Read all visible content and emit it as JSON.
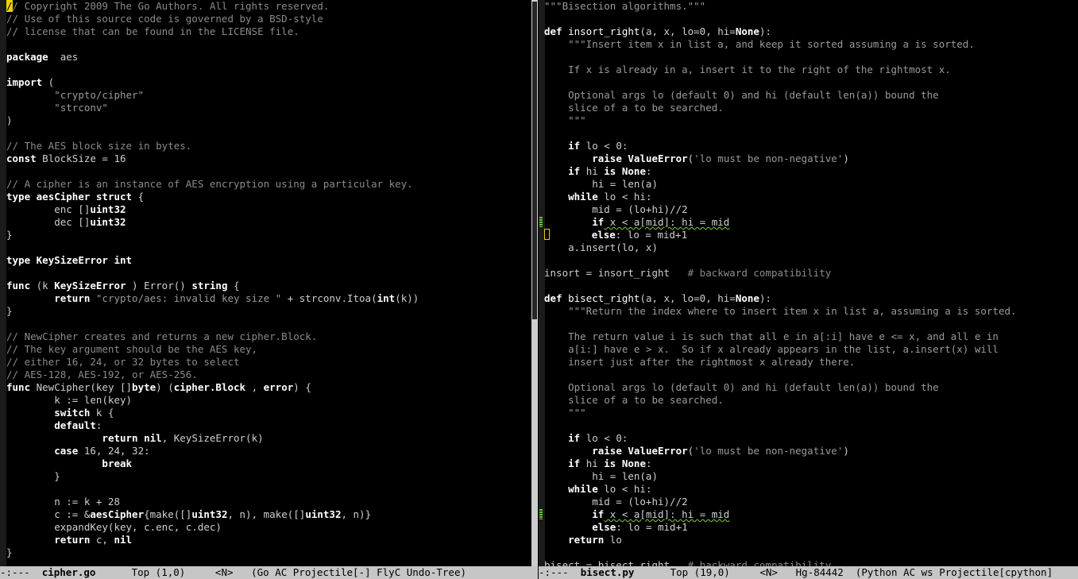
{
  "left": {
    "lines": [
      [
        [
          "cursor",
          "/"
        ],
        [
          "cm",
          "/ Copyright 2009 The Go Authors. All rights reserved."
        ]
      ],
      [
        [
          "cm",
          "// Use of this source code is governed by a BSD-style"
        ]
      ],
      [
        [
          "cm",
          "// license that can be found in the LICENSE file."
        ]
      ],
      [],
      [
        [
          "kw",
          "package"
        ],
        [
          "",
          "  aes"
        ]
      ],
      [],
      [
        [
          "kw",
          "import"
        ],
        [
          "",
          " ("
        ]
      ],
      [
        [
          "",
          "        "
        ],
        [
          "st",
          "\"crypto/cipher\""
        ]
      ],
      [
        [
          "",
          "        "
        ],
        [
          "st",
          "\"strconv\""
        ]
      ],
      [
        [
          "",
          ")"
        ]
      ],
      [],
      [
        [
          "cm",
          "// The AES block size in bytes."
        ]
      ],
      [
        [
          "kw",
          "const"
        ],
        [
          "",
          " BlockSize = 16"
        ]
      ],
      [],
      [
        [
          "cm",
          "// A cipher is an instance of AES encryption using a particular key."
        ]
      ],
      [
        [
          "kw",
          "type"
        ],
        [
          "",
          " "
        ],
        [
          "tp",
          "aesCipher"
        ],
        [
          "",
          " "
        ],
        [
          "kw",
          "struct"
        ],
        [
          "",
          " {"
        ]
      ],
      [
        [
          "",
          "        enc []"
        ],
        [
          "tp",
          "uint32"
        ]
      ],
      [
        [
          "",
          "        dec []"
        ],
        [
          "tp",
          "uint32"
        ]
      ],
      [
        [
          "",
          "}"
        ]
      ],
      [],
      [
        [
          "kw",
          "type"
        ],
        [
          "",
          " "
        ],
        [
          "tp",
          "KeySizeError"
        ],
        [
          "",
          " "
        ],
        [
          "tp",
          "int"
        ]
      ],
      [],
      [
        [
          "kw",
          "func"
        ],
        [
          "",
          " (k "
        ],
        [
          "tp",
          "KeySizeError"
        ],
        [
          "",
          " ) Error() "
        ],
        [
          "tp",
          "string"
        ],
        [
          "",
          " {"
        ]
      ],
      [
        [
          "",
          "        "
        ],
        [
          "kw",
          "return"
        ],
        [
          "",
          " "
        ],
        [
          "st",
          "\"crypto/aes: invalid key size \""
        ],
        [
          "",
          " + strconv.Itoa("
        ],
        [
          "tp",
          "int"
        ],
        [
          "",
          "(k))"
        ]
      ],
      [
        [
          "",
          "}"
        ]
      ],
      [],
      [
        [
          "cm",
          "// NewCipher creates and returns a new cipher.Block."
        ]
      ],
      [
        [
          "cm",
          "// The key argument should be the AES key,"
        ]
      ],
      [
        [
          "cm",
          "// either 16, 24, or 32 bytes to select"
        ]
      ],
      [
        [
          "cm",
          "// AES-128, AES-192, or AES-256."
        ]
      ],
      [
        [
          "kw",
          "func"
        ],
        [
          "",
          " NewCipher(key []"
        ],
        [
          "tp",
          "byte"
        ],
        [
          "",
          ") ("
        ],
        [
          "tp",
          "cipher.Block"
        ],
        [
          "",
          " , "
        ],
        [
          "tp",
          "error"
        ],
        [
          "",
          ") {"
        ]
      ],
      [
        [
          "",
          "        k := len(key)"
        ]
      ],
      [
        [
          "",
          "        "
        ],
        [
          "kw",
          "switch"
        ],
        [
          "",
          " k {"
        ]
      ],
      [
        [
          "",
          "        "
        ],
        [
          "kw",
          "default"
        ],
        [
          "",
          ":"
        ]
      ],
      [
        [
          "",
          "                "
        ],
        [
          "kw",
          "return"
        ],
        [
          "",
          " "
        ],
        [
          "kw",
          "nil"
        ],
        [
          "",
          ", KeySizeError(k)"
        ]
      ],
      [
        [
          "",
          "        "
        ],
        [
          "kw",
          "case"
        ],
        [
          "",
          " 16, 24, 32:"
        ]
      ],
      [
        [
          "",
          "                "
        ],
        [
          "kw",
          "break"
        ]
      ],
      [
        [
          "",
          "        }"
        ]
      ],
      [],
      [
        [
          "",
          "        n := k + 28"
        ]
      ],
      [
        [
          "",
          "        c := &"
        ],
        [
          "tp",
          "aesCipher"
        ],
        [
          "",
          "{make([]"
        ],
        [
          "tp",
          "uint32"
        ],
        [
          "",
          ", n), make([]"
        ],
        [
          "tp",
          "uint32"
        ],
        [
          "",
          ", n)}"
        ]
      ],
      [
        [
          "",
          "        expandKey(key, c.enc, c.dec)"
        ]
      ],
      [
        [
          "",
          "        "
        ],
        [
          "kw",
          "return"
        ],
        [
          "",
          " c, "
        ],
        [
          "kw",
          "nil"
        ]
      ],
      [
        [
          "",
          "}"
        ]
      ]
    ],
    "modeline": {
      "prefix": "-:---  ",
      "buffer": "cipher.go",
      "rest": "      Top (1,0)     <N>   (Go AC Projectile[-] FlyC Undo-Tree)"
    }
  },
  "right": {
    "lines": [
      [
        [
          "st",
          "\"\"\"Bisection algorithms.\"\"\""
        ]
      ],
      [],
      [
        [
          "kw",
          "def"
        ],
        [
          "",
          " "
        ],
        [
          "fn",
          "insort_right"
        ],
        [
          "",
          "(a, x, lo=0, hi="
        ],
        [
          "kw",
          "None"
        ],
        [
          "",
          "):"
        ]
      ],
      [
        [
          "",
          "    "
        ],
        [
          "st",
          "\"\"\"Insert item x in list a, and keep it sorted assuming a is sorted."
        ]
      ],
      [],
      [
        [
          "st",
          "    If x is already in a, insert it to the right of the rightmost x."
        ]
      ],
      [],
      [
        [
          "st",
          "    Optional args lo (default 0) and hi (default len(a)) bound the"
        ]
      ],
      [
        [
          "st",
          "    slice of a to be searched."
        ]
      ],
      [
        [
          "st",
          "    \"\"\""
        ]
      ],
      [],
      [
        [
          "",
          "    "
        ],
        [
          "kw",
          "if"
        ],
        [
          "",
          " lo < 0:"
        ]
      ],
      [
        [
          "",
          "        "
        ],
        [
          "kw",
          "raise"
        ],
        [
          "",
          " "
        ],
        [
          "tp",
          "ValueError"
        ],
        [
          "",
          "("
        ],
        [
          "st",
          "'lo must be non-negative'"
        ],
        [
          "",
          ")"
        ]
      ],
      [
        [
          "",
          "    "
        ],
        [
          "kw",
          "if"
        ],
        [
          "",
          " hi "
        ],
        [
          "kw",
          "is"
        ],
        [
          "",
          " "
        ],
        [
          "kw",
          "None"
        ],
        [
          "",
          ":"
        ]
      ],
      [
        [
          "",
          "        hi = len(a)"
        ]
      ],
      [
        [
          "",
          "    "
        ],
        [
          "kw",
          "while"
        ],
        [
          "",
          " lo < hi:"
        ]
      ],
      [
        [
          "",
          "        mid = (lo+hi)//2"
        ]
      ],
      [
        [
          "",
          "        "
        ],
        [
          "kw",
          "if"
        ],
        [
          "sq",
          " x < a[mid]: hi = mid"
        ]
      ],
      [
        [
          "hollow",
          ""
        ],
        [
          "",
          "       "
        ],
        [
          "kw",
          "else"
        ],
        [
          "",
          ": lo = mid+1"
        ]
      ],
      [
        [
          "",
          "    a.insert(lo, x)"
        ]
      ],
      [],
      [
        [
          "",
          "insort = insort_right   "
        ],
        [
          "cm",
          "# backward compatibility"
        ]
      ],
      [],
      [
        [
          "kw",
          "def"
        ],
        [
          "",
          " "
        ],
        [
          "fn",
          "bisect_right"
        ],
        [
          "",
          "(a, x, lo=0, hi="
        ],
        [
          "kw",
          "None"
        ],
        [
          "",
          "):"
        ]
      ],
      [
        [
          "",
          "    "
        ],
        [
          "st",
          "\"\"\"Return the index where to insert item x in list a, assuming a is sorted."
        ]
      ],
      [],
      [
        [
          "st",
          "    The return value i is such that all e in a[:i] have e <= x, and all e in"
        ]
      ],
      [
        [
          "st",
          "    a[i:] have e > x.  So if x already appears in the list, a.insert(x) will"
        ]
      ],
      [
        [
          "st",
          "    insert just after the rightmost x already there."
        ]
      ],
      [],
      [
        [
          "st",
          "    Optional args lo (default 0) and hi (default len(a)) bound the"
        ]
      ],
      [
        [
          "st",
          "    slice of a to be searched."
        ]
      ],
      [
        [
          "st",
          "    \"\"\""
        ]
      ],
      [],
      [
        [
          "",
          "    "
        ],
        [
          "kw",
          "if"
        ],
        [
          "",
          " lo < 0:"
        ]
      ],
      [
        [
          "",
          "        "
        ],
        [
          "kw",
          "raise"
        ],
        [
          "",
          " "
        ],
        [
          "tp",
          "ValueError"
        ],
        [
          "",
          "("
        ],
        [
          "st",
          "'lo must be non-negative'"
        ],
        [
          "",
          ")"
        ]
      ],
      [
        [
          "",
          "    "
        ],
        [
          "kw",
          "if"
        ],
        [
          "",
          " hi "
        ],
        [
          "kw",
          "is"
        ],
        [
          "",
          " "
        ],
        [
          "kw",
          "None"
        ],
        [
          "",
          ":"
        ]
      ],
      [
        [
          "",
          "        hi = len(a)"
        ]
      ],
      [
        [
          "",
          "    "
        ],
        [
          "kw",
          "while"
        ],
        [
          "",
          " lo < hi:"
        ]
      ],
      [
        [
          "",
          "        mid = (lo+hi)//2"
        ]
      ],
      [
        [
          "",
          "        "
        ],
        [
          "kw",
          "if"
        ],
        [
          "sq",
          " x < a[mid]: hi = mid"
        ]
      ],
      [
        [
          "",
          "        "
        ],
        [
          "kw",
          "else"
        ],
        [
          "",
          ": lo = mid+1"
        ]
      ],
      [
        [
          "",
          "    "
        ],
        [
          "kw",
          "return"
        ],
        [
          "",
          " lo"
        ]
      ],
      [],
      [
        [
          "",
          "bisect = bisect_right   "
        ],
        [
          "cm",
          "# backward compatibility"
        ]
      ]
    ],
    "flymake_lines": [
      17,
      40
    ],
    "modeline": {
      "prefix": "-:---  ",
      "buffer": "bisect.py",
      "rest": "      Top (19,0)     <N>   Hg-84442  (Python AC ws Projectile[cpython]"
    }
  },
  "colors": {
    "background": "#000000",
    "modeline_bg": "#c6c6c6",
    "cursor": "#f0d000",
    "flymake": "#6bc03a"
  }
}
